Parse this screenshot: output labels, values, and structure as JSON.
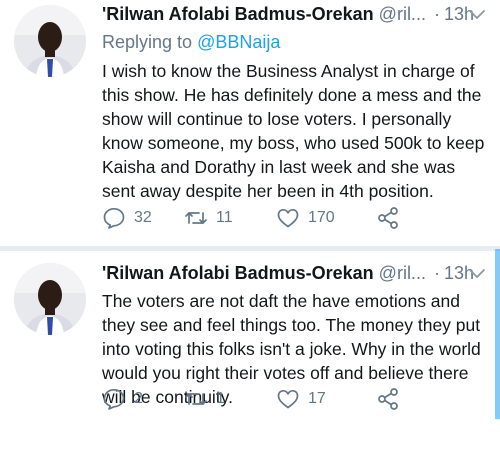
{
  "tweets": [
    {
      "author_name": "'Rilwan Afolabi Badmus-Orekan",
      "handle": "@ril...",
      "separator": "·",
      "time": "13h",
      "reply_prefix": "Replying to",
      "reply_to": "@BBNaija",
      "text": "I wish to know the Business Analyst in charge of this show. He has definitely done a mess and the show will continue to lose voters. I personally know someone, my boss, who used 500k to keep Kaisha and Dorathy in last week and she was sent away despite her been in 4th position.",
      "replies": "32",
      "retweets": "11",
      "likes": "170"
    },
    {
      "author_name": "'Rilwan Afolabi Badmus-Orekan",
      "handle": "@ril...",
      "separator": "·",
      "time": "13h",
      "text": "The voters are not daft the have emotions and they see and feel things too. The money they put into voting this folks isn't a joke. Why in the world would you right their votes off and believe there will be continuity.",
      "replies": "2",
      "retweets": "1",
      "likes": "17"
    }
  ],
  "colors": {
    "text": "#14171a",
    "muted": "#657786",
    "accent": "#1da1f2",
    "divider": "#e6ecf0"
  },
  "icons": [
    "reply-icon",
    "retweet-icon",
    "like-icon",
    "share-icon",
    "chevron-down-icon"
  ]
}
